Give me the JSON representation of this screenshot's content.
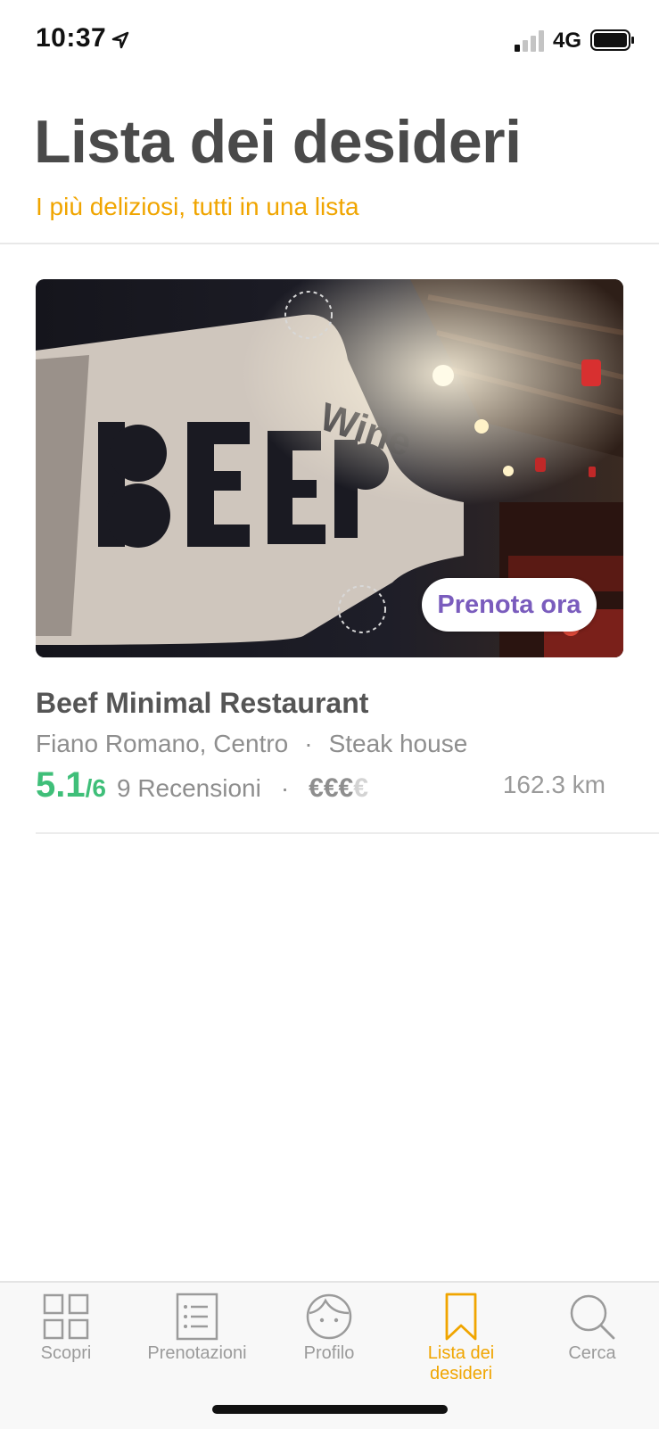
{
  "status_bar": {
    "time": "10:37",
    "network": "4G"
  },
  "header": {
    "title": "Lista dei desideri",
    "subtitle": "I più deliziosi, tutti in una lista"
  },
  "restaurant": {
    "name": "Beef Minimal Restaurant",
    "location": "Fiano Romano, Centro",
    "separator": "·",
    "cuisine": "Steak house",
    "rating": "5.1",
    "rating_max": "/6",
    "reviews": "9 Recensioni",
    "price_active": "€€€",
    "price_inactive": "€",
    "distance": "162.3 km",
    "book_button": "Prenota ora"
  },
  "tabs": [
    {
      "label": "Scopri",
      "icon": "grid-icon",
      "active": false
    },
    {
      "label": "Prenotazioni",
      "icon": "list-icon",
      "active": false
    },
    {
      "label": "Profilo",
      "icon": "face-icon",
      "active": false
    },
    {
      "label": "Lista dei desideri",
      "icon": "bookmark-icon",
      "active": true
    },
    {
      "label": "Cerca",
      "icon": "search-icon",
      "active": false
    }
  ],
  "colors": {
    "accent": "#f0a500",
    "rating": "#3fbf79",
    "button_text": "#7a5cbd"
  }
}
